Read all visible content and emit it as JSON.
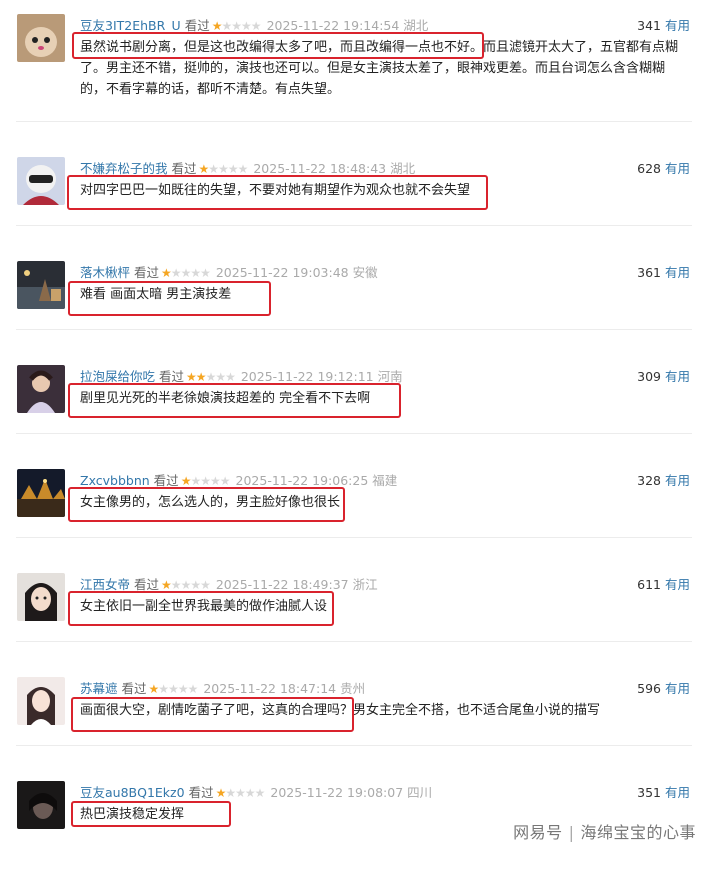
{
  "comments": [
    {
      "user": "豆友3IT2EhBR_U",
      "watched": "看过",
      "rating": 1,
      "meta": "2025-11-22 19:14:54 湖北",
      "votes": "341",
      "useful": "有用",
      "text": "虽然说书剧分离，但是这也改编得太多了吧，而且改编得一点也不好。而且滤镜开太大了，五官都有点糊了。男主还不错，挺帅的，演技也还可以。但是女主演技太差了，眼神戏更差。而且台词怎么含含糊糊的，不看字幕的话，都听不清楚。有点失望。"
    },
    {
      "user": "不嫌弃松子的我",
      "watched": "看过",
      "rating": 1,
      "meta": "2025-11-22 18:48:43 湖北",
      "votes": "628",
      "useful": "有用",
      "text": "对四字巴巴一如既往的失望，不要对她有期望作为观众也就不会失望"
    },
    {
      "user": "落木楸枰",
      "watched": "看过",
      "rating": 1,
      "meta": "2025-11-22 19:03:48 安徽",
      "votes": "361",
      "useful": "有用",
      "text": "难看 画面太暗 男主演技差"
    },
    {
      "user": "拉泡屎给你吃",
      "watched": "看过",
      "rating": 2,
      "meta": "2025-11-22 19:12:11 河南",
      "votes": "309",
      "useful": "有用",
      "text": "剧里见光死的半老徐娘演技超差的 完全看不下去啊"
    },
    {
      "user": "Zxcvbbbnn",
      "watched": "看过",
      "rating": 1,
      "meta": "2025-11-22 19:06:25 福建",
      "votes": "328",
      "useful": "有用",
      "text": "女主像男的，怎么选人的，男主脸好像也很长"
    },
    {
      "user": "江西女帝",
      "watched": "看过",
      "rating": 1,
      "meta": "2025-11-22 18:49:37 浙江",
      "votes": "611",
      "useful": "有用",
      "text": "女主依旧一副全世界我最美的做作油腻人设"
    },
    {
      "user": "苏幕遮",
      "watched": "看过",
      "rating": 1,
      "meta": "2025-11-22 18:47:14 贵州",
      "votes": "596",
      "useful": "有用",
      "text": "画面很大空，剧情吃菌子了吧，这真的合理吗？男女主完全不搭，也不适合尾鱼小说的描写"
    },
    {
      "user": "豆友au8BQ1Ekz0",
      "watched": "看过",
      "rating": 1,
      "meta": "2025-11-22 19:08:07 四川",
      "votes": "351",
      "useful": "有用",
      "text": "热巴演技稳定发挥"
    }
  ],
  "watermark": {
    "platform": "网易号",
    "account": "海绵宝宝的心事"
  },
  "colors": {
    "username": "#3377aa",
    "star": "#f5a623",
    "highlight_box": "#d9232d"
  }
}
